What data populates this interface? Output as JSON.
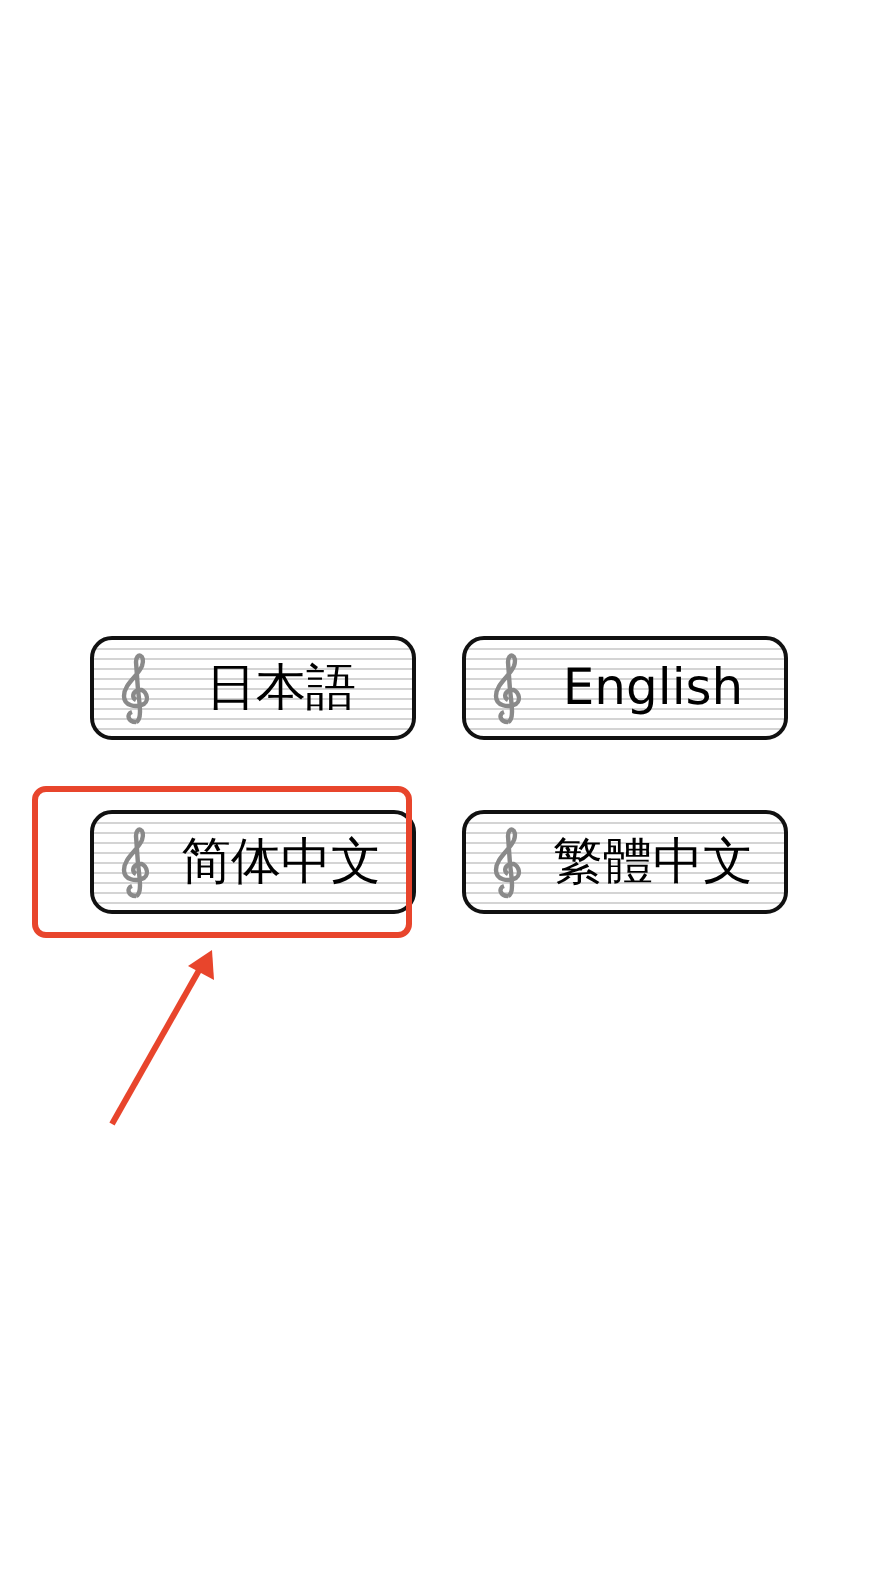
{
  "languages": [
    {
      "label": "日本語",
      "highlighted": false
    },
    {
      "label": "English",
      "highlighted": false
    },
    {
      "label": "简体中文",
      "highlighted": true
    },
    {
      "label": "繁體中文",
      "highlighted": false
    }
  ]
}
